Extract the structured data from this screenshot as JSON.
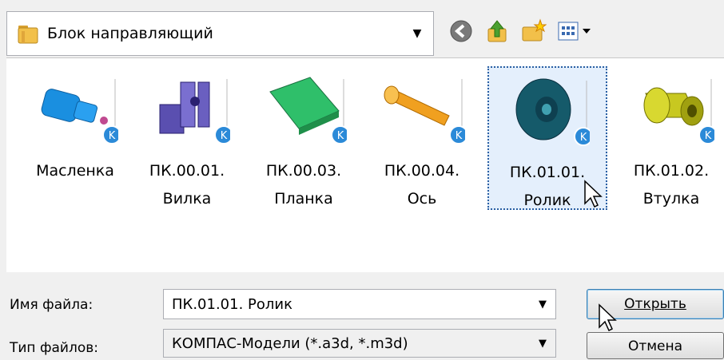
{
  "window": {
    "look_in": {
      "label": "Блок направляющий",
      "icon": "folder-icon"
    },
    "toolbar": [
      {
        "name": "back-button",
        "icon": "back-arrow-icon"
      },
      {
        "name": "up-folder-button",
        "icon": "up-folder-icon"
      },
      {
        "name": "new-folder-button",
        "icon": "new-folder-icon"
      },
      {
        "name": "view-menu-button",
        "icon": "view-menu-icon"
      }
    ]
  },
  "files": [
    {
      "name": "Масленка",
      "color": "#1a8fe0"
    },
    {
      "name": "ПК.00.01.\nВилка",
      "color": "#5a4fb0"
    },
    {
      "name": "ПК.00.03.\nПланка",
      "color": "#2fbf6a"
    },
    {
      "name": "ПК.00.04.\nОсь",
      "color": "#f0a020"
    },
    {
      "name": "ПК.01.01.\nРолик",
      "color": "#155a6a",
      "selected": true
    },
    {
      "name": "ПК.01.02.\nВтулка",
      "color": "#c8c820"
    }
  ],
  "form": {
    "file_name_label": "Имя файла:",
    "file_name_value": "ПК.01.01. Ролик",
    "file_type_label": "Тип файлов:",
    "file_type_value": "КОМПАС-Модели (*.a3d, *.m3d)",
    "open_button": "Открыть",
    "cancel_button": "Отмена"
  },
  "colors": {
    "selection": "#e4effc",
    "badge": "#2b8ad8"
  }
}
